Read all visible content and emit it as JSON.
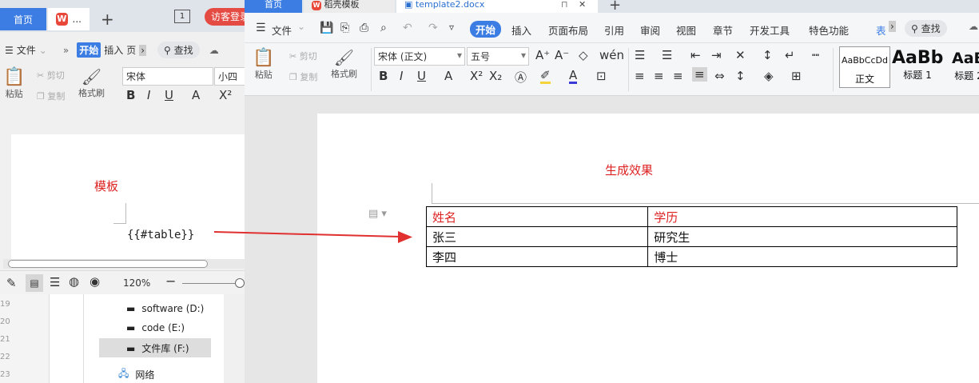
{
  "back": {
    "tabs": {
      "home": "首页",
      "doc": "..."
    },
    "visitor_login": "访客登录",
    "menu": {
      "file": "文件",
      "more": "»",
      "start": "开始",
      "insert": "插入",
      "page": "页"
    },
    "search": "查找",
    "ribbon": {
      "paste": "粘贴",
      "cut": "剪切",
      "copy": "复制",
      "format_painter": "格式刷",
      "font_name": "宋体",
      "font_size": "小四"
    },
    "template_label": "模板",
    "placeholder": "{{#table}}",
    "zoom": "120%",
    "line_numbers": [
      "19",
      "20",
      "21",
      "22",
      "23"
    ],
    "drives": [
      {
        "label": "software (D:)"
      },
      {
        "label": "code (E:)"
      },
      {
        "label": "文件库 (F:)"
      }
    ],
    "network": "网络"
  },
  "main": {
    "tabs": {
      "home": "首页",
      "templates": "稻壳模板",
      "doc": "template2.docx"
    },
    "menu": {
      "file": "文件",
      "start": "开始",
      "insert": "插入",
      "layout": "页面布局",
      "references": "引用",
      "review": "审阅",
      "view": "视图",
      "chapter": "章节",
      "developer": "开发工具",
      "special": "特色功能",
      "table": "表"
    },
    "search": "查找",
    "ribbon": {
      "paste": "粘贴",
      "cut": "剪切",
      "copy": "复制",
      "format_painter": "格式刷",
      "font_name": "宋体 (正文)",
      "font_size": "五号"
    },
    "styles": {
      "normal_preview": "AaBbCcDd",
      "normal": "正文",
      "h1_preview": "AaBb",
      "h1": "标题 1",
      "h2_preview": "AaB",
      "h2": "标题 2"
    },
    "result_label": "生成效果",
    "table": {
      "headers": [
        "姓名",
        "学历"
      ],
      "rows": [
        [
          "张三",
          "研究生"
        ],
        [
          "李四",
          "博士"
        ]
      ]
    }
  },
  "colors": {
    "accent": "#3b7de3",
    "red_label": "#d22222",
    "arrow": "#e03030"
  }
}
